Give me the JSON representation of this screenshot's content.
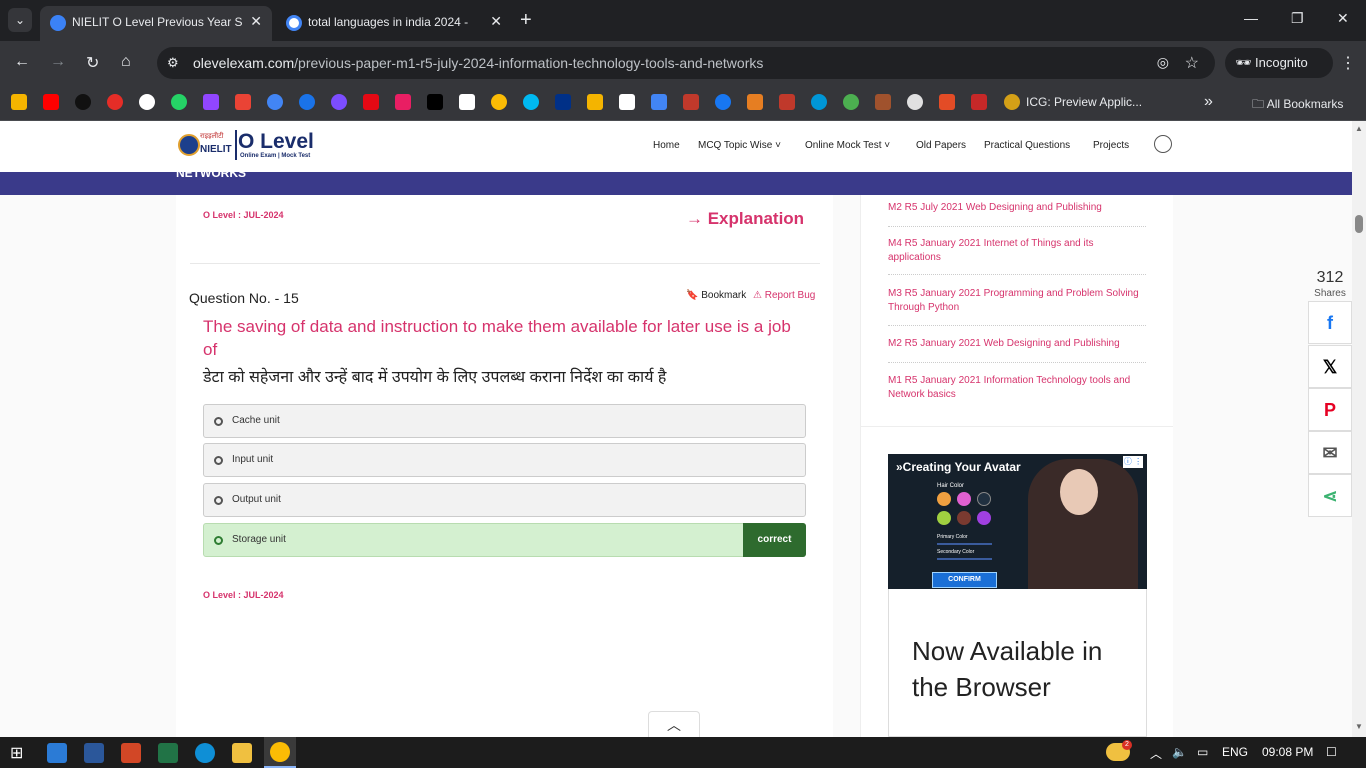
{
  "browser": {
    "tabs": [
      {
        "title": "NIELIT O Level Previous Year So",
        "active": true
      },
      {
        "title": "total languages in india 2024 - ",
        "active": false
      }
    ],
    "url_domain": "olevelexam.com",
    "url_path": "/previous-paper-m1-r5-july-2024-information-technology-tools-and-networks",
    "incognito_label": "Incognito",
    "bookmark_visible_label": "ICG: Preview Applic...",
    "all_bookmarks_label": "All Bookmarks"
  },
  "site": {
    "logo": {
      "main": "O Level",
      "sub": "NIELIT",
      "hindi": "राइइलीटी",
      "tagline": "Online Exam | Mock Test"
    },
    "nav": {
      "home": "Home",
      "mcq": "MCQ Topic Wise",
      "mock": "Online Mock Test",
      "old_papers": "Old Papers",
      "practical": "Practical Questions",
      "projects": "Projects"
    },
    "strip_text": "NETWORKS"
  },
  "question_prev": {
    "tag": "O Level : JUL-2024",
    "explanation": "→ Explanation"
  },
  "question": {
    "number_label": "Question No. - 15",
    "bookmark_label": "Bookmark",
    "report_label": "Report Bug",
    "text_en": "The saving of data and instruction to make them available for later use is a job of",
    "text_hi": "डेटा को सहेजना और उन्हें बाद में उपयोग के लिए उपलब्ध कराना निर्देश का कार्य है",
    "options": [
      "Cache unit",
      "Input unit",
      "Output unit",
      "Storage unit"
    ],
    "correct_label": "correct",
    "tag": "O Level : JUL-2024"
  },
  "sidebar": {
    "links": [
      "M2 R5 July 2021 Web Designing and Publishing",
      "M4 R5 January 2021 Internet of Things and its applications",
      "M3 R5 January 2021 Programming and Problem Solving Through Python",
      "M2 R5 January 2021 Web Designing and Publishing",
      "M1 R5 January 2021 Information Technology tools and Network basics"
    ],
    "ad": {
      "title": "»Creating Your Avatar",
      "hair_color": "Hair Color",
      "primary_color": "Primary Color",
      "secondary_color": "Secondary Color",
      "confirm": "CONFIRM",
      "info": "ⓘ ⋮"
    },
    "ad2_text": "Now Available in the Browser"
  },
  "share": {
    "count": "312",
    "label": "Shares"
  },
  "taskbar": {
    "lang": "ENG",
    "time": "09:08 PM",
    "weather_badge": "2"
  },
  "colors": {
    "accent": "#d6336c",
    "strip": "#3a3a8a",
    "correct": "#2e6b2e",
    "correct_bg": "#d4f0d0"
  }
}
